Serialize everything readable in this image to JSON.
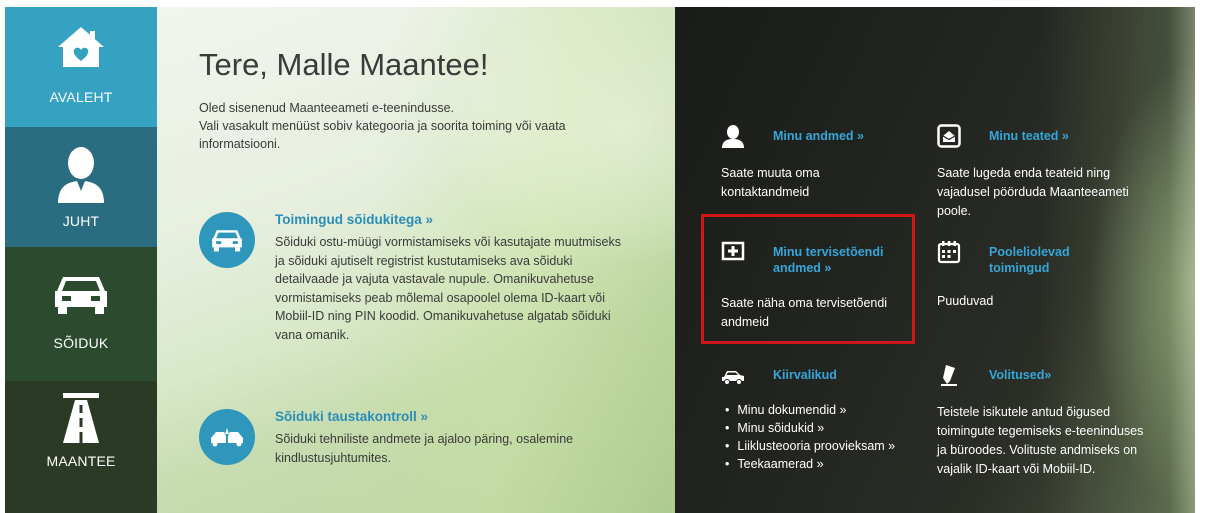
{
  "sidebar": {
    "items": [
      {
        "label": "AVALEHT",
        "icon": "home-heart-icon"
      },
      {
        "label": "JUHT",
        "icon": "person-icon"
      },
      {
        "label": "SÕIDUK",
        "icon": "car-icon"
      },
      {
        "label": "MAANTEE",
        "icon": "road-icon"
      }
    ]
  },
  "main": {
    "greeting": "Tere, Malle Maantee!",
    "intro_line1": "Oled sisenenud Maanteeameti e-teenindusse.",
    "intro_line2": "Vali vasakult menüüst sobiv kategooria ja sooritа toiming või vaata informatsiooni.",
    "features": [
      {
        "title": "Toimingud sõidukitega »",
        "desc": "Sõiduki ostu-müügi vormistamiseks või kasutajate muutmiseks ja sõiduki ajutiselt registrist kustutamiseks ava sõiduki detailvaade ja vajuta vastavale nupule. Omanikuvahetuse vormistamiseks peab mõlemal osapoolel olema ID-kaart või Mobiil-ID ning PIN koodid. Omanikuvahetuse algatab sõiduki vana omanik."
      },
      {
        "title": "Sõiduki taustakontroll »",
        "desc": "Sõiduki tehniliste andmete ja ajaloo päring, osalemine kindlustusjuhtumites."
      }
    ]
  },
  "panel": {
    "my_data": {
      "title": "Minu andmed »",
      "text": "Saate muuta oma kontaktandmeid"
    },
    "my_messages": {
      "title": "Minu teated »",
      "text": "Saate lugeda enda teateid ning vajadusel pöörduda Maanteeameti poole."
    },
    "health": {
      "title_line1": "Minu tervisetõendi",
      "title_line2": "andmed »",
      "text": "Saate näha oma tervisetõendi andmeid"
    },
    "pending": {
      "title_line1": "Pooleliolevad",
      "title_line2": "toimingud",
      "text": "Puuduvad"
    },
    "quick": {
      "title": "Kiirvalikud",
      "links": [
        "Minu dokumendid »",
        "Minu sõidukid »",
        "Liiklusteooria proovieksam »",
        "Teekaamerad »"
      ]
    },
    "authorizations": {
      "title": "Volitused»",
      "text": "Teistele isikutele antud õigused toimingute tegemiseks e-teeninduses ja büroodes. Volituste andmiseks on vajalik ID-kaart või Mobiil-ID."
    }
  },
  "colors": {
    "accent": "#35a6d8",
    "highlight": "#d0161b",
    "sidebar_active": "#35a2c2"
  }
}
